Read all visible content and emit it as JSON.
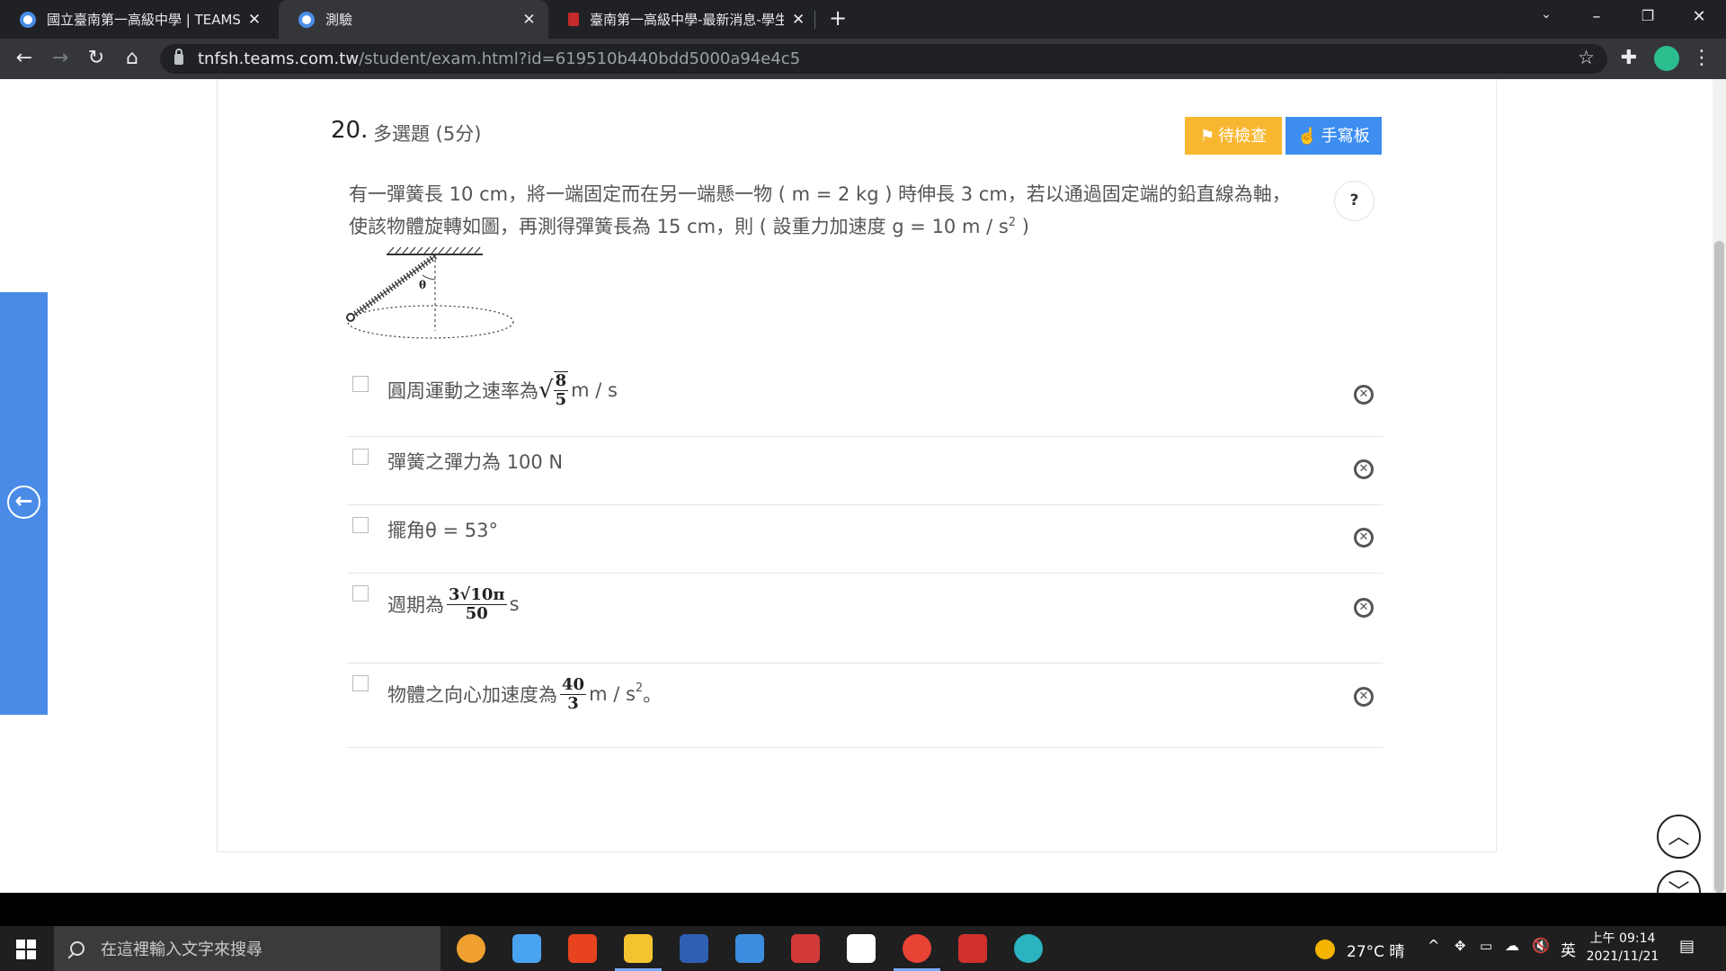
{
  "browser": {
    "tabs": [
      {
        "title": "國立臺南第一高級中學 | TEAMS",
        "active": false
      },
      {
        "title": "測驗",
        "active": true
      },
      {
        "title": "臺南第一高級中學-最新消息-學生",
        "active": false
      }
    ],
    "url_host": "tnfsh.teams.com.tw",
    "url_path": "/student/exam.html?id=619510b440bdd5000a94e4c5"
  },
  "question": {
    "number": "20.",
    "type": "多選題 (5分)",
    "review_label": "待檢查",
    "handwriting_label": "手寫板",
    "help_label": "?",
    "stem_line1": "有一彈簧長 10 cm，將一端固定而在另一端懸一物 ( m = 2 kg ) 時伸長 3 cm，若以通過固定端的鉛直線為軸，",
    "stem_line2a": "使該物體旋轉如圖，再測得彈簧長為 15 cm，則 ( 設重力加速度 g = 10 m / s",
    "stem_line2_sup": "2",
    "stem_line2b": " )",
    "figure_label": "θ"
  },
  "options": {
    "a": {
      "text": "圓周運動之速率為",
      "sqrt_num": "8",
      "sqrt_den": "5",
      "unit": " m / s"
    },
    "b": {
      "text": "彈簧之彈力為 100 N"
    },
    "c": {
      "text": "擺角θ = 53°"
    },
    "d": {
      "text": "週期為",
      "num": "3√10π",
      "den": "50",
      "unit": " s"
    },
    "e": {
      "text": "物體之向心加速度為",
      "num": "40",
      "den": "3",
      "unit": " m / s",
      "sup": "2",
      "tail": " 。"
    }
  },
  "taskbar": {
    "search_placeholder": "在這裡輸入文字來搜尋",
    "weather": "27°C 晴",
    "ime": "英",
    "time": "上午 09:14",
    "date": "2021/11/21"
  }
}
